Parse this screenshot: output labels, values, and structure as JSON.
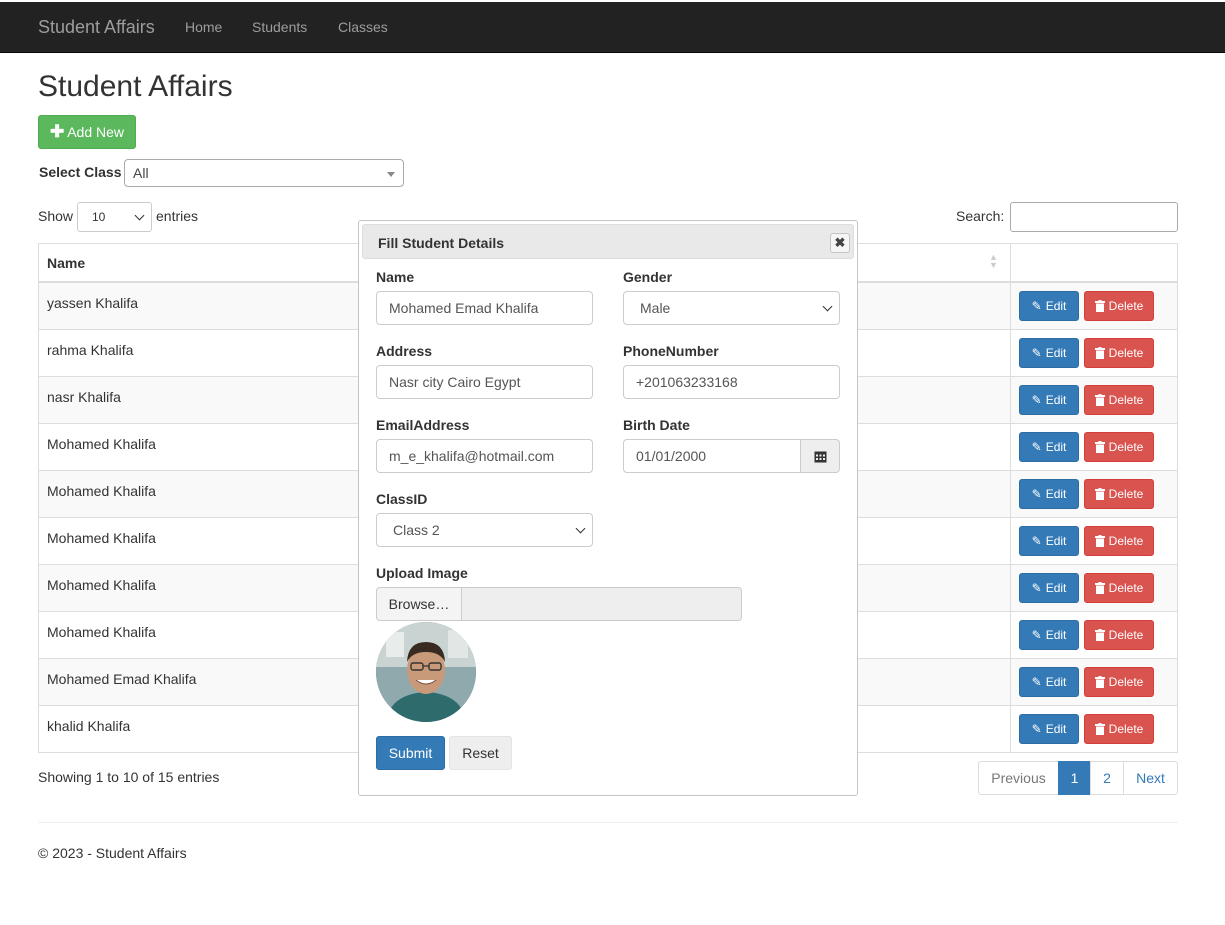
{
  "navbar": {
    "brand": "Student Affairs",
    "links": [
      "Home",
      "Students",
      "Classes"
    ]
  },
  "page": {
    "title": "Student Affairs",
    "add_button": "Add New",
    "select_class_label": "Select Class",
    "select_class_value": "All",
    "show_label": "Show",
    "show_value": "10",
    "entries_label": "entries",
    "search_label": "Search:"
  },
  "table": {
    "header_name": "Name",
    "rows": [
      {
        "name": "yassen Khalifa"
      },
      {
        "name": "rahma Khalifa"
      },
      {
        "name": "nasr Khalifa"
      },
      {
        "name": "Mohamed Khalifa"
      },
      {
        "name": "Mohamed Khalifa"
      },
      {
        "name": "Mohamed Khalifa"
      },
      {
        "name": "Mohamed Khalifa"
      },
      {
        "name": "Mohamed Khalifa"
      },
      {
        "name": "Mohamed Emad Khalifa"
      },
      {
        "name": "khalid Khalifa"
      }
    ],
    "edit_label": "Edit",
    "delete_label": "Delete",
    "info": "Showing 1 to 10 of 15 entries"
  },
  "pagination": {
    "previous": "Previous",
    "pages": [
      "1",
      "2"
    ],
    "active_page": "1",
    "next": "Next"
  },
  "footer": {
    "text": "© 2023 - Student Affairs"
  },
  "modal": {
    "title": "Fill Student Details",
    "close": "✖",
    "name_label": "Name",
    "name_value": "Mohamed Emad Khalifa",
    "gender_label": "Gender",
    "gender_value": "Male",
    "address_label": "Address",
    "address_value": "Nasr city Cairo Egypt",
    "phone_label": "PhoneNumber",
    "phone_value": "+201063233168",
    "email_label": "EmailAddress",
    "email_value": "m_e_khalifa@hotmail.com",
    "birth_label": "Birth Date",
    "birth_value": "01/01/2000",
    "class_label": "ClassID",
    "class_value": "Class 2",
    "upload_label": "Upload Image",
    "browse_label": "Browse…",
    "submit_label": "Submit",
    "reset_label": "Reset"
  },
  "colors": {
    "navbar_bg": "#222222",
    "success": "#5cb85c",
    "primary": "#337ab7",
    "danger": "#d9534f"
  },
  "icons": {
    "add": "plus-icon",
    "edit": "edit-icon",
    "delete": "trash-icon",
    "calendar": "calendar-icon",
    "close": "close-icon"
  }
}
